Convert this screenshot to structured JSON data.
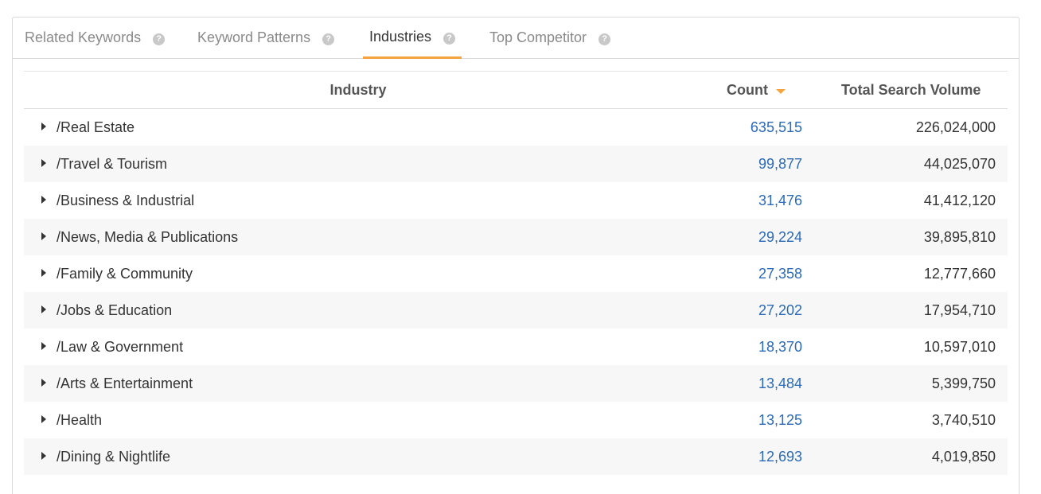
{
  "tabs": [
    {
      "label": "Related Keywords",
      "active": false
    },
    {
      "label": "Keyword Patterns",
      "active": false
    },
    {
      "label": "Industries",
      "active": true
    },
    {
      "label": "Top Competitor",
      "active": false
    }
  ],
  "help_glyph": "?",
  "table": {
    "headers": {
      "industry": "Industry",
      "count": "Count",
      "volume": "Total Search Volume"
    },
    "sort": {
      "column": "count",
      "direction": "desc"
    },
    "rows": [
      {
        "industry": "/Real Estate",
        "count": "635,515",
        "volume": "226,024,000"
      },
      {
        "industry": "/Travel & Tourism",
        "count": "99,877",
        "volume": "44,025,070"
      },
      {
        "industry": "/Business & Industrial",
        "count": "31,476",
        "volume": "41,412,120"
      },
      {
        "industry": "/News, Media & Publications",
        "count": "29,224",
        "volume": "39,895,810"
      },
      {
        "industry": "/Family & Community",
        "count": "27,358",
        "volume": "12,777,660"
      },
      {
        "industry": "/Jobs & Education",
        "count": "27,202",
        "volume": "17,954,710"
      },
      {
        "industry": "/Law & Government",
        "count": "18,370",
        "volume": "10,597,010"
      },
      {
        "industry": "/Arts & Entertainment",
        "count": "13,484",
        "volume": "5,399,750"
      },
      {
        "industry": "/Health",
        "count": "13,125",
        "volume": "3,740,510"
      },
      {
        "industry": "/Dining & Nightlife",
        "count": "12,693",
        "volume": "4,019,850"
      }
    ]
  },
  "colors": {
    "accent": "#f5a33c",
    "link": "#2a6ab8",
    "row_alt": "#f7f7f7"
  }
}
